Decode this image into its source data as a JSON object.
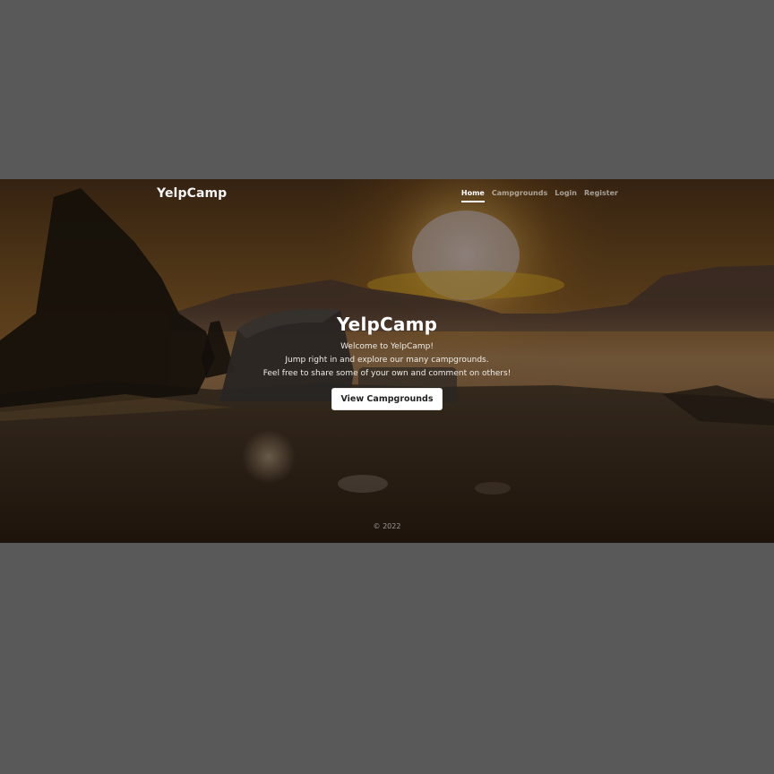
{
  "navbar": {
    "brand": "YelpCamp",
    "links": [
      {
        "label": "Home",
        "active": true
      },
      {
        "label": "Campgrounds",
        "active": false
      },
      {
        "label": "Login",
        "active": false
      },
      {
        "label": "Register",
        "active": false
      }
    ]
  },
  "hero": {
    "title": "YelpCamp",
    "lines": [
      "Welcome to YelpCamp!",
      "Jump right in and explore our many campgrounds.",
      "Feel free to share some of your own and comment on others!"
    ],
    "button_label": "View Campgrounds"
  },
  "footer": {
    "text": "© 2022"
  },
  "colors": {
    "letterbox": "#595959",
    "sky": "#6b4a22",
    "sun": "#f2c860",
    "mountains": "#4a3a30",
    "ground": "#3a2a18",
    "button_bg": "#ffffff"
  },
  "icons": {
    "background": "sunset-campsite-photo"
  }
}
